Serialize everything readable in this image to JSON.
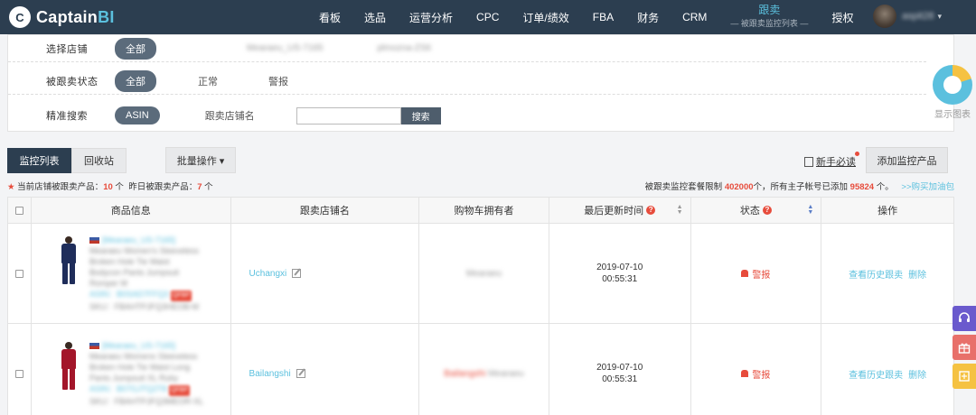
{
  "nav": {
    "logo_mark": "C",
    "logo_main": "Captain",
    "logo_bi": "BI",
    "items": [
      "看板",
      "选品",
      "运营分析",
      "CPC",
      "订单/绩效",
      "FBA",
      "财务",
      "CRM"
    ],
    "active": {
      "label": "跟卖",
      "sub": "— 被跟卖监控列表 —"
    },
    "auth": "授权",
    "username": "aspit28",
    "caret": "▾"
  },
  "filter": {
    "shop_label": "选择店铺",
    "shop_all": "全部",
    "shop_1": "Mearaeu_US-7165",
    "shop_2": "plmozna-ZS6",
    "status_label": "被跟卖状态",
    "status_all": "全部",
    "status_normal": "正常",
    "status_alarm": "警报",
    "search_label": "精准搜索",
    "search_type": "ASIN",
    "seller_label": "跟卖店铺名",
    "search_value": "",
    "search_button": "搜索"
  },
  "widget": {
    "label": "显示图表"
  },
  "toolbar": {
    "tab_monitor": "监控列表",
    "tab_recycle": "回收站",
    "batch": "批量操作 ▾",
    "guide": "新手必读",
    "add": "添加监控产品"
  },
  "info": {
    "star": "★",
    "left_a": "当前店铺被跟卖产品：",
    "left_a_num": "10",
    "left_a_unit": "个",
    "left_b": "昨日被跟卖产品：",
    "left_b_num": "7",
    "left_b_unit": "个",
    "right_a": "被跟卖监控套餐限制",
    "right_a_num": "402000",
    "right_b": "个，所有主子帐号已添加",
    "right_b_num": "95824",
    "right_c": "个。",
    "buy_link": ">>购买加油包"
  },
  "table": {
    "headers": [
      "商品信息",
      "跟卖店铺名",
      "购物车拥有者",
      "最后更新时间",
      "状态",
      "操作"
    ],
    "help_glyph": "?",
    "rows": [
      {
        "shop": "[Mearaeu_US-7165]",
        "title": [
          "Mearaeu Women's Sleeveless",
          "Broken Hole Tie Waist",
          "Bodycon Pants Jumpsuit",
          "Romper M"
        ],
        "asin": "ASIN：B0SAD7FFQ3",
        "tag": "QFBP",
        "sku": "SKU：FBAHTPJFQ3HEOB-M",
        "seller": "Uchangxi",
        "owner_red": "",
        "owner": "Mearaeu",
        "date": "2019-07-10",
        "time": "00:55:31",
        "status": "警报",
        "op_history": "查看历史跟卖",
        "op_delete": "删除",
        "color": "navy"
      },
      {
        "shop": "[Mearaeu_US-7165]",
        "title": [
          "Mearaeu Womens Sleeveless",
          "Broken Hole Tie Waist Long",
          "Pants Jumpsuit XL Ruby"
        ],
        "asin": "ASIN：B07GJTQ2T8",
        "tag": "QFBP",
        "sku": "SKU：FBAHTPJFQ3MEOR-XL",
        "seller": "Bailangshi",
        "owner_red": "Bailangshi",
        "owner": "Mearaeu",
        "date": "2019-07-10",
        "time": "00:55:31",
        "status": "警报",
        "op_history": "查看历史跟卖",
        "op_delete": "删除",
        "color": "red"
      }
    ]
  },
  "colors": {
    "nav_bg": "#2c3e50",
    "accent": "#5bc0de",
    "alert": "#e74c3c"
  }
}
